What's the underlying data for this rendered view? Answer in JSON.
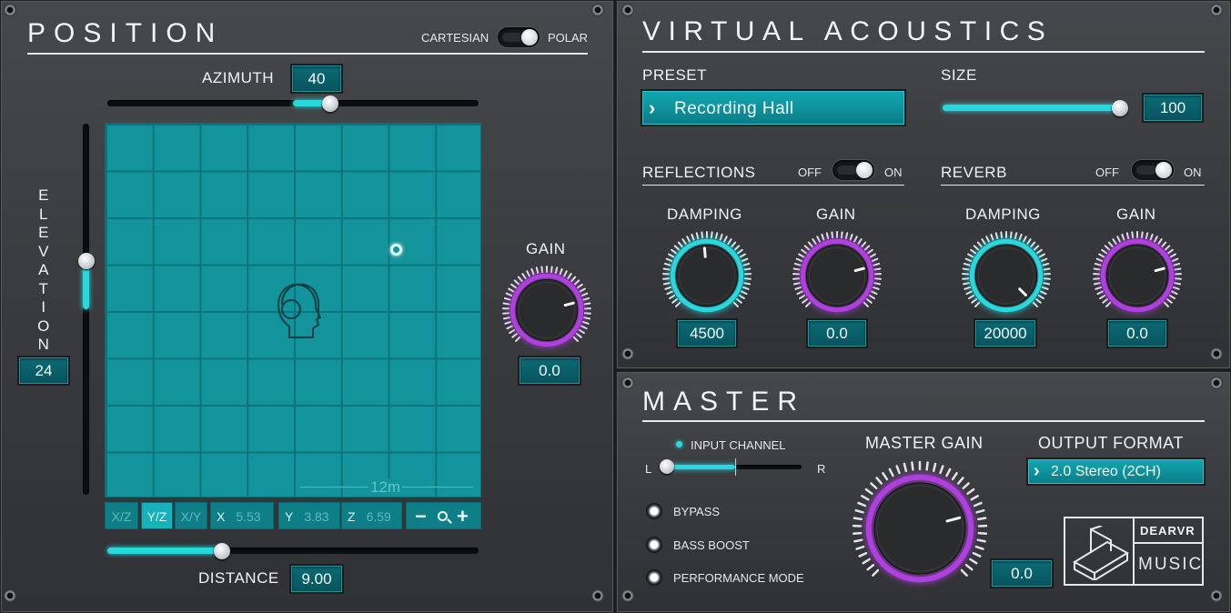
{
  "position": {
    "title": "POSITION",
    "mode_left": "CARTESIAN",
    "mode_right": "POLAR",
    "azimuth_label": "AZIMUTH",
    "azimuth_value": "40",
    "elevation_label": "ELEVATION",
    "elevation_value": "24",
    "gain_label": "GAIN",
    "gain_value": "0.0",
    "distance_label": "DISTANCE",
    "distance_value": "9.00",
    "scale_label": "12m",
    "tabs": [
      "X/Z",
      "Y/Z",
      "X/Y"
    ],
    "active_tab": "Y/Z",
    "coords": {
      "x_label": "X",
      "x_value": "5.53",
      "y_label": "Y",
      "y_value": "3.83",
      "z_label": "Z",
      "z_value": "6.59"
    },
    "zoom_minus": "−",
    "zoom_plus": "+",
    "zoom_icon": "magnifier-icon",
    "azimuth_level": 0.6,
    "elevation_level": 0.63,
    "distance_level": 0.31
  },
  "acoustics": {
    "title": "VIRTUAL ACOUSTICS",
    "preset_label": "PRESET",
    "preset_value": "Recording Hall",
    "size_label": "SIZE",
    "size_value": "100",
    "size_level": 1.0,
    "reflections_label": "REFLECTIONS",
    "reverb_label": "REVERB",
    "off_label": "OFF",
    "on_label": "ON",
    "refl_damping_label": "DAMPING",
    "refl_damping_value": "4500",
    "refl_gain_label": "GAIN",
    "refl_gain_value": "0.0",
    "rev_damping_label": "DAMPING",
    "rev_damping_value": "20000",
    "rev_gain_label": "GAIN",
    "rev_gain_value": "0.0"
  },
  "master": {
    "title": "MASTER",
    "input_channel_label": "INPUT CHANNEL",
    "left_label": "L",
    "right_label": "R",
    "bypass_label": "BYPASS",
    "bass_boost_label": "BASS BOOST",
    "performance_mode_label": "PERFORMANCE MODE",
    "master_gain_label": "MASTER GAIN",
    "master_gain_value": "0.0",
    "output_format_label": "OUTPUT FORMAT",
    "output_format_value": "2.0 Stereo (2CH)",
    "logo_top": "DEARVR",
    "logo_bottom": "MUSIC"
  },
  "colors": {
    "accent": "#27d9de",
    "knob_purple": "#b03ee0",
    "knob_cyan": "#27d9de",
    "grid": "#13939b"
  }
}
